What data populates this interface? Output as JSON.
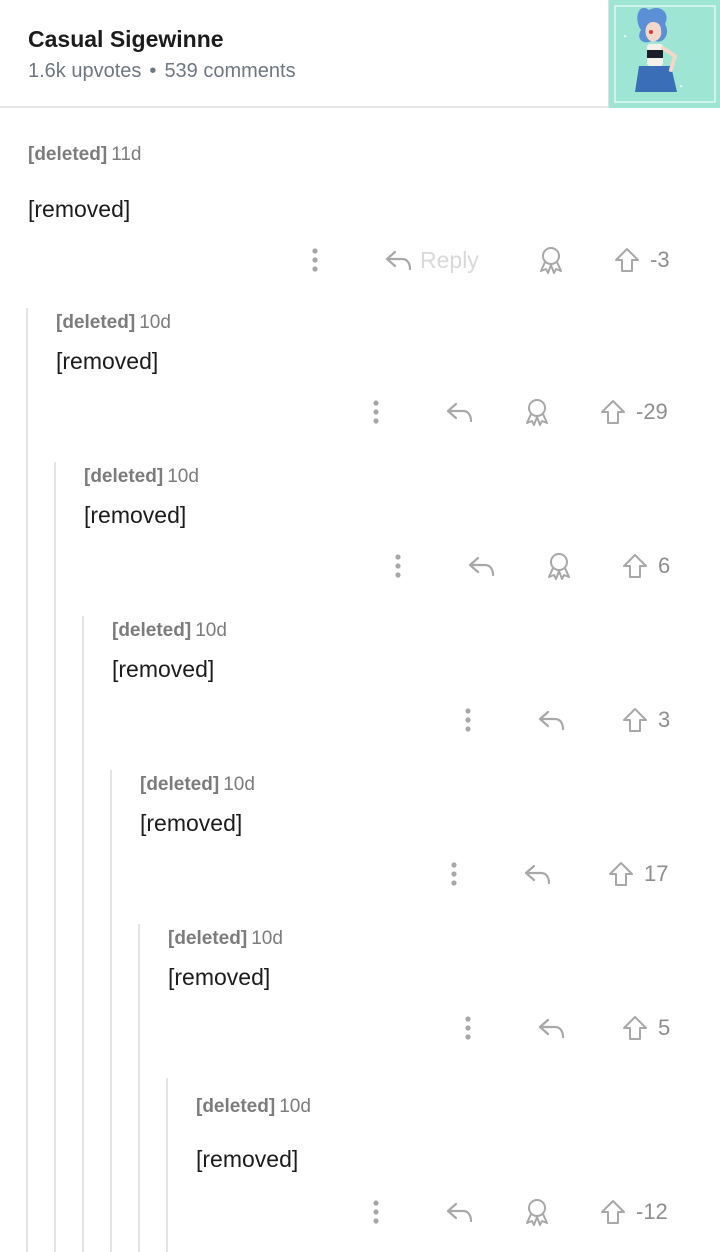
{
  "post": {
    "title": "Casual Sigewinne",
    "upvotes": "1.6k upvotes",
    "separator": "•",
    "comments": "539 comments",
    "thumbnail_icon": "post-thumbnail-image"
  },
  "colors": {
    "text_primary": "#1c1c1c",
    "text_meta": "#7c7c7c",
    "icon_gray": "#a8a8a8",
    "thread_line": "#e4e4e4"
  },
  "comments": [
    {
      "author": "[deleted]",
      "time": "11d",
      "body": "[removed]",
      "reply_label": "Reply",
      "votes": "-3",
      "has_award": true
    },
    {
      "author": "[deleted]",
      "time": "10d",
      "body": "[removed]",
      "votes": "-29",
      "has_award": true
    },
    {
      "author": "[deleted]",
      "time": "10d",
      "body": "[removed]",
      "votes": "6",
      "has_award": true
    },
    {
      "author": "[deleted]",
      "time": "10d",
      "body": "[removed]",
      "votes": "3",
      "has_award": false
    },
    {
      "author": "[deleted]",
      "time": "10d",
      "body": "[removed]",
      "votes": "17",
      "has_award": false
    },
    {
      "author": "[deleted]",
      "time": "10d",
      "body": "[removed]",
      "votes": "5",
      "has_award": false
    },
    {
      "author": "[deleted]",
      "time": "10d",
      "body": "[removed]",
      "votes": "-12",
      "has_award": true
    }
  ]
}
